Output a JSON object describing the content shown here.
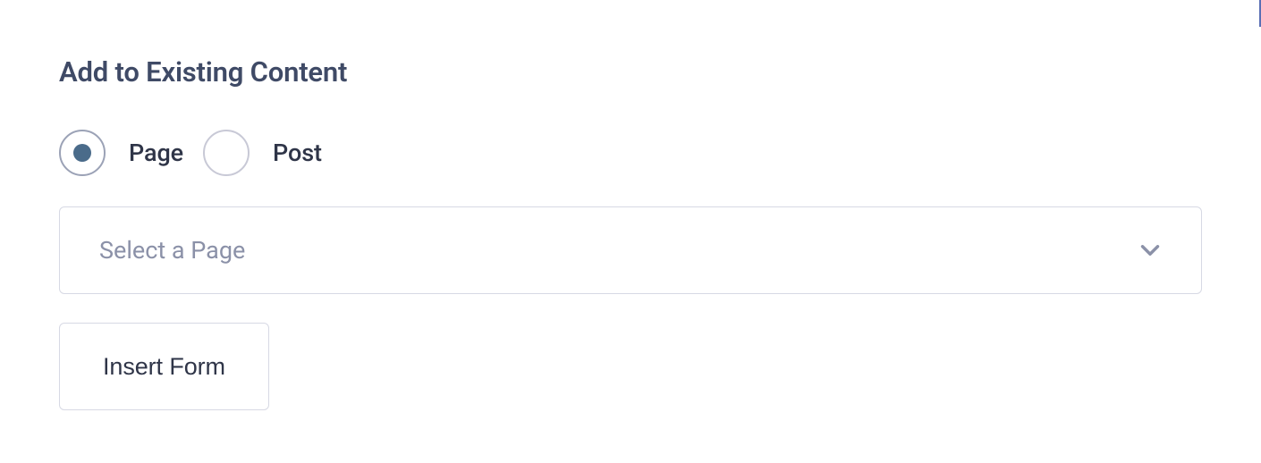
{
  "section": {
    "title": "Add to Existing Content"
  },
  "radios": {
    "page": {
      "label": "Page",
      "selected": true
    },
    "post": {
      "label": "Post",
      "selected": false
    }
  },
  "select": {
    "placeholder": "Select a Page"
  },
  "button": {
    "label": "Insert Form"
  }
}
